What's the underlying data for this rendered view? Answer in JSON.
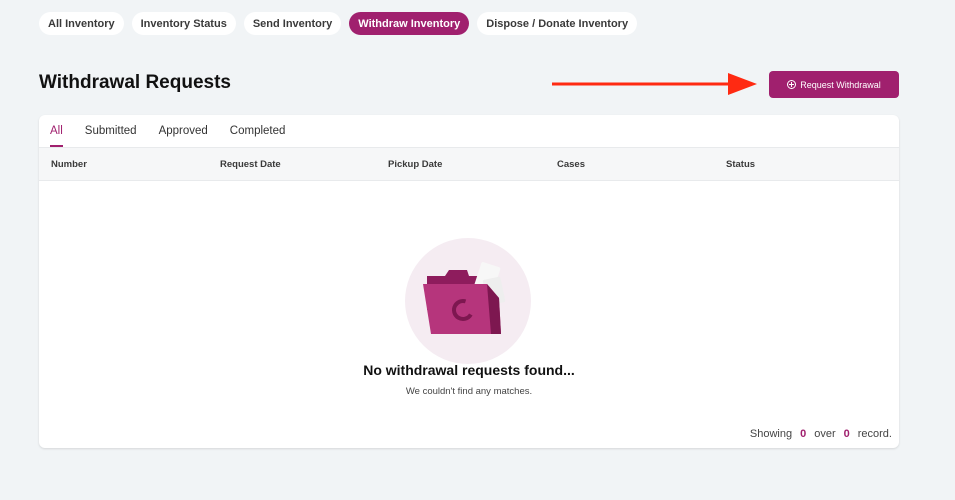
{
  "top_tabs": [
    {
      "label": "All Inventory"
    },
    {
      "label": "Inventory Status"
    },
    {
      "label": "Send Inventory"
    },
    {
      "label": "Withdraw Inventory"
    },
    {
      "label": "Dispose / Donate Inventory"
    }
  ],
  "active_top_tab": "Withdraw Inventory",
  "page_title": "Withdrawal Requests",
  "request_button": {
    "label": "Request Withdrawal",
    "icon": "plus-circle-icon"
  },
  "filter_tabs": [
    {
      "label": "All"
    },
    {
      "label": "Submitted"
    },
    {
      "label": "Approved"
    },
    {
      "label": "Completed"
    }
  ],
  "active_filter_tab": "All",
  "table": {
    "columns": [
      "Number",
      "Request Date",
      "Pickup Date",
      "Cases",
      "Status"
    ]
  },
  "empty_state": {
    "title": "No withdrawal requests found...",
    "subtitle": "We couldn't find any matches.",
    "icon": "empty-folder-icon"
  },
  "footer": {
    "showing_label": "Showing",
    "shown_count": "0",
    "over_label": "over",
    "total_count": "0",
    "record_label": "record."
  },
  "colors": {
    "accent": "#a0206e",
    "annotation_arrow": "#ff2a12",
    "background": "#f1f4f6"
  }
}
